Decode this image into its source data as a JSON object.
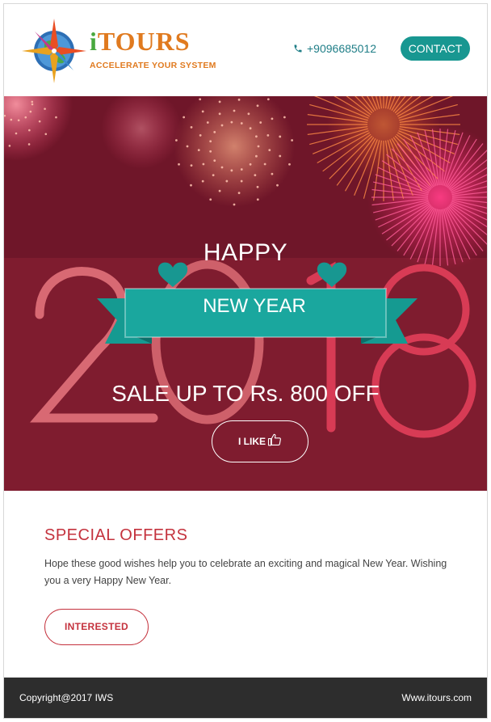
{
  "header": {
    "brand_name": "TOURS",
    "brand_prefix": "i",
    "tagline": "ACCELERATE YOUR SYSTEM",
    "phone": "+9096685012",
    "contact_label": "CONTACT"
  },
  "hero": {
    "happy": "HAPPY",
    "ribbon_text": "NEW YEAR",
    "year": "2018",
    "sale": "SALE UP TO Rs. 800 OFF",
    "like_label": "I LIKE"
  },
  "offers": {
    "title": "SPECIAL OFFERS",
    "text": "Hope these good wishes help you to celebrate an exciting and magical New Year. Wishing you a very Happy New Year.",
    "button_label": "INTERESTED"
  },
  "footer": {
    "copyright": "Copyright@2017 IWS",
    "website": "Www.itours.com"
  },
  "colors": {
    "accent": "#189791",
    "brand_orange": "#e07a1f",
    "brand_green": "#48a83e",
    "offer_red": "#c4323d",
    "hero_bg": "#7f1c2f",
    "footer_bg": "#2d2d2d"
  },
  "icons": [
    "compass-logo-icon",
    "phone-icon",
    "heart-icon",
    "thumbs-up-icon"
  ]
}
